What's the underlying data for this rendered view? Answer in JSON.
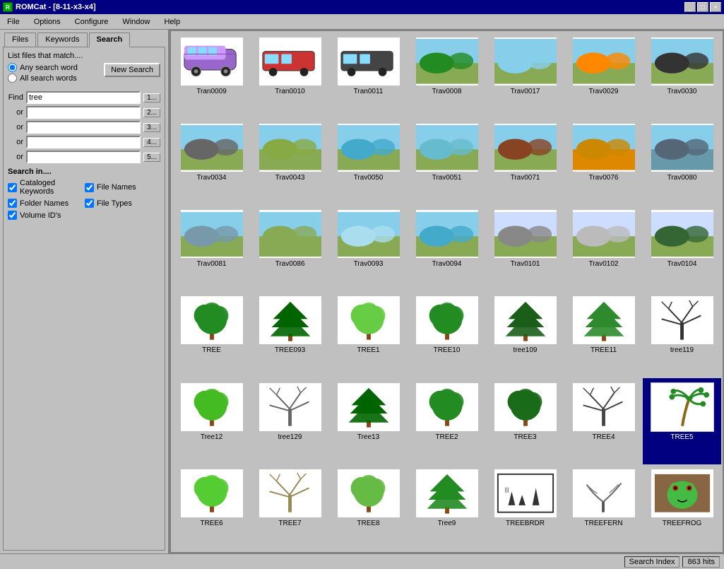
{
  "titleBar": {
    "title": "ROMCat - [8-11-x3-x4]",
    "icon": "R",
    "buttons": [
      "_",
      "□",
      "×"
    ]
  },
  "menuBar": {
    "items": [
      "File",
      "Options",
      "Configure",
      "Window",
      "Help"
    ]
  },
  "tabs": [
    {
      "id": "files",
      "label": "Files"
    },
    {
      "id": "keywords",
      "label": "Keywords"
    },
    {
      "id": "search",
      "label": "Search",
      "active": true
    }
  ],
  "searchPanel": {
    "listFilesLabel": "List files that match....",
    "radioOptions": [
      {
        "id": "any",
        "label": "Any search word",
        "checked": true
      },
      {
        "id": "all",
        "label": "All search words",
        "checked": false
      }
    ],
    "newSearchBtn": "New Search",
    "findLabel": "Find",
    "findValue": "tree",
    "findBtnLabel": "1...",
    "orRows": [
      {
        "label": "or",
        "value": "",
        "btn": "2..."
      },
      {
        "label": "or",
        "value": "",
        "btn": "3..."
      },
      {
        "label": "or",
        "value": "",
        "btn": "4..."
      },
      {
        "label": "or",
        "value": "",
        "btn": "5..."
      }
    ],
    "searchInLabel": "Search in....",
    "checkboxes": [
      {
        "id": "cataloged",
        "label": "Cataloged Keywords",
        "checked": true
      },
      {
        "id": "filenames",
        "label": "File Names",
        "checked": true
      },
      {
        "id": "foldernames",
        "label": "Folder Names",
        "checked": true
      },
      {
        "id": "filetypes",
        "label": "File Types",
        "checked": true
      },
      {
        "id": "volumeids",
        "label": "Volume ID's",
        "checked": true
      }
    ]
  },
  "statusBar": {
    "searchIndexLabel": "Search Index",
    "hitsLabel": "863 hits"
  },
  "grid": {
    "items": [
      {
        "name": "Tran0009",
        "type": "transport",
        "color": "#9966cc"
      },
      {
        "name": "Tran0010",
        "type": "transport",
        "color": "#cc3333"
      },
      {
        "name": "Tran0011",
        "type": "transport",
        "color": "#444444"
      },
      {
        "name": "Trav0008",
        "type": "landscape",
        "color": "#228b22"
      },
      {
        "name": "Trav0017",
        "type": "landscape",
        "color": "#87ceeb"
      },
      {
        "name": "Trav0029",
        "type": "landscape",
        "color": "#ff8800"
      },
      {
        "name": "Trav0030",
        "type": "landscape",
        "color": "#333333"
      },
      {
        "name": "Trav0034",
        "type": "landscape",
        "color": "#666666"
      },
      {
        "name": "Trav0043",
        "type": "landscape",
        "color": "#88aa44"
      },
      {
        "name": "Trav0050",
        "type": "landscape",
        "color": "#44aacc"
      },
      {
        "name": "Trav0051",
        "type": "landscape",
        "color": "#66bbcc"
      },
      {
        "name": "Trav0071",
        "type": "landscape",
        "color": "#884422"
      },
      {
        "name": "Trav0076",
        "type": "landscape",
        "color": "#cc8800"
      },
      {
        "name": "Trav0080",
        "type": "landscape",
        "color": "#556677"
      },
      {
        "name": "Trav0081",
        "type": "landscape",
        "color": "#7799aa"
      },
      {
        "name": "Trav0086",
        "type": "landscape",
        "color": "#88aa55"
      },
      {
        "name": "Trav0093",
        "type": "landscape",
        "color": "#aaddee"
      },
      {
        "name": "Trav0094",
        "type": "landscape",
        "color": "#44aacc"
      },
      {
        "name": "Trav0101",
        "type": "landscape",
        "color": "#888888"
      },
      {
        "name": "Trav0102",
        "type": "landscape",
        "color": "#bbbbbb"
      },
      {
        "name": "Trav0104",
        "type": "landscape",
        "color": "#336633"
      },
      {
        "name": "TREE",
        "type": "tree",
        "color": "#228b22"
      },
      {
        "name": "TREE093",
        "type": "tree-pine",
        "color": "#006400"
      },
      {
        "name": "TREE1",
        "type": "tree",
        "color": "#66cc44"
      },
      {
        "name": "TREE10",
        "type": "tree",
        "color": "#228b22"
      },
      {
        "name": "tree109",
        "type": "tree-pine",
        "color": "#1a5e1a"
      },
      {
        "name": "TREE11",
        "type": "tree-pine",
        "color": "#2d8b2d"
      },
      {
        "name": "tree119",
        "type": "tree-bare",
        "color": "#333333"
      },
      {
        "name": "Tree12",
        "type": "tree",
        "color": "#44bb22"
      },
      {
        "name": "tree129",
        "type": "tree-bare",
        "color": "#666666"
      },
      {
        "name": "Tree13",
        "type": "tree-pine",
        "color": "#006400"
      },
      {
        "name": "TREE2",
        "type": "tree",
        "color": "#228b22"
      },
      {
        "name": "TREE3",
        "type": "tree",
        "color": "#1a6b1a"
      },
      {
        "name": "TREE4",
        "type": "tree-bare",
        "color": "#444444"
      },
      {
        "name": "TREE5",
        "type": "tree-palm",
        "color": "#228b22",
        "selected": true
      },
      {
        "name": "TREE6",
        "type": "tree",
        "color": "#55cc33"
      },
      {
        "name": "TREE7",
        "type": "tree-bare",
        "color": "#998855"
      },
      {
        "name": "TREE8",
        "type": "tree",
        "color": "#66bb44"
      },
      {
        "name": "Tree9",
        "type": "tree-pine",
        "color": "#228b22"
      },
      {
        "name": "TREEBRDR",
        "type": "tree-border",
        "color": "#333333"
      },
      {
        "name": "TREEFERN",
        "type": "tree-fern",
        "color": "#777777"
      },
      {
        "name": "TREEFROG",
        "type": "frog",
        "color": "#44bb44"
      }
    ]
  }
}
